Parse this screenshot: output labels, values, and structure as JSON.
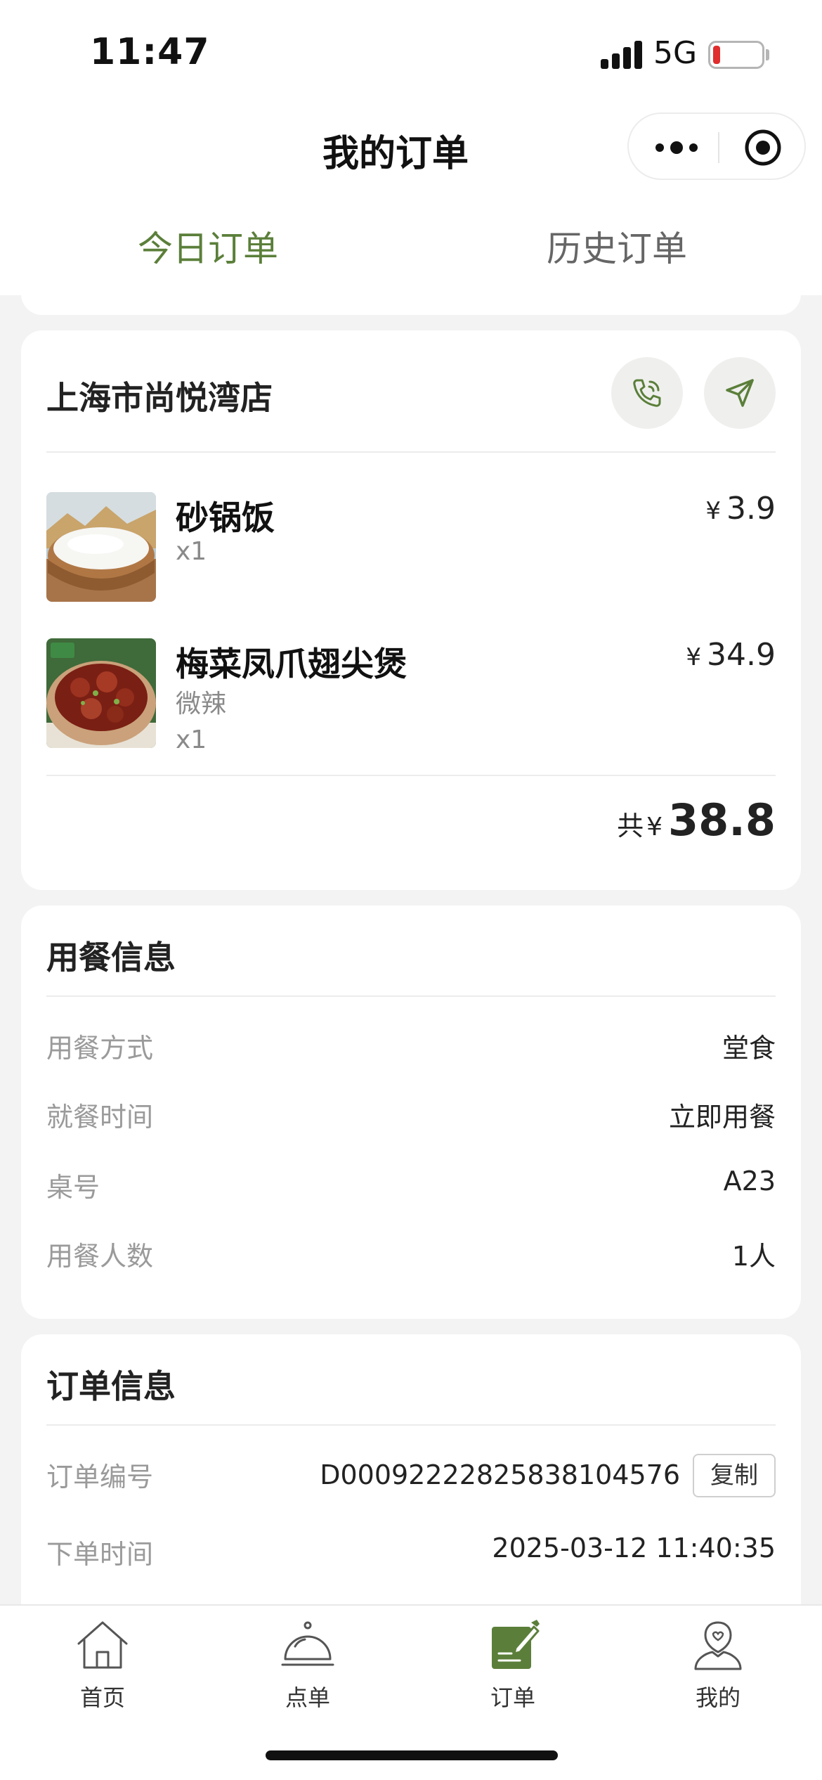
{
  "status_bar": {
    "time": "11:47",
    "network": "5G",
    "battery_color": "#e02d2d"
  },
  "nav": {
    "title": "我的订单"
  },
  "tabs": [
    {
      "label": "今日订单",
      "active": true
    },
    {
      "label": "历史订单",
      "active": false
    }
  ],
  "theme": {
    "accent": "#5b7f3a",
    "background": "#f3f3f3"
  },
  "store": {
    "name": "上海市尚悦湾店",
    "phone_icon": "phone-icon",
    "navigate_icon": "navigate-icon"
  },
  "items": [
    {
      "name": "砂锅饭",
      "options": [],
      "quantity": "x1",
      "currency": "¥",
      "price": "3.9"
    },
    {
      "name": "梅菜凤爪翅尖煲",
      "options": [
        "微辣"
      ],
      "quantity": "x1",
      "currency": "¥",
      "price": "34.9"
    }
  ],
  "total": {
    "label": "共",
    "currency": "¥",
    "amount": "38.8"
  },
  "meal_info": {
    "title": "用餐信息",
    "rows": [
      {
        "label": "用餐方式",
        "value": "堂食"
      },
      {
        "label": "就餐时间",
        "value": "立即用餐"
      },
      {
        "label": "桌号",
        "value": "A23"
      },
      {
        "label": "用餐人数",
        "value": "1人"
      }
    ]
  },
  "order_info": {
    "title": "订单信息",
    "order_number_label": "订单编号",
    "order_number": "D00092222825838104576",
    "copy_label": "复制",
    "order_time_label": "下单时间",
    "order_time": "2025-03-12 11:40:35"
  },
  "tabbar": [
    {
      "label": "首页",
      "icon": "home-icon",
      "active": false
    },
    {
      "label": "点单",
      "icon": "cloche-icon",
      "active": false
    },
    {
      "label": "订单",
      "icon": "order-icon",
      "active": true
    },
    {
      "label": "我的",
      "icon": "profile-icon",
      "active": false
    }
  ]
}
